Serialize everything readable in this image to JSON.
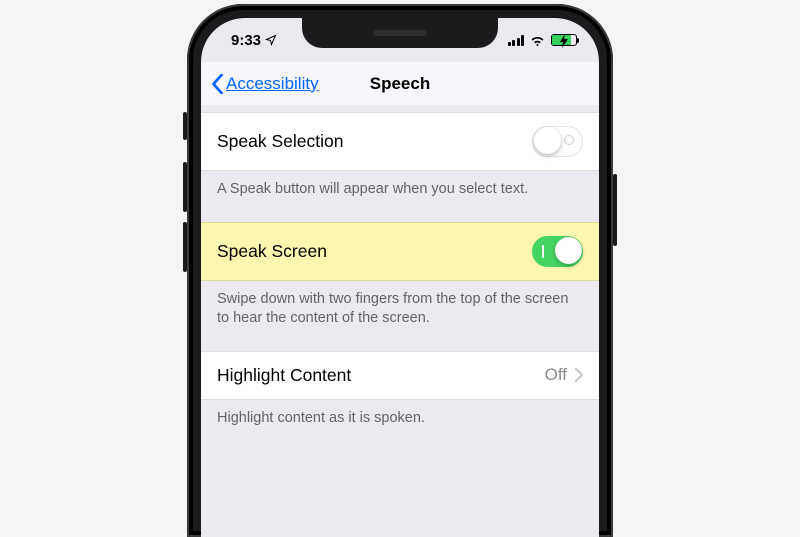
{
  "status": {
    "time": "9:33",
    "location_icon": "location-arrow"
  },
  "nav": {
    "back_label": "Accessibility",
    "title": "Speech"
  },
  "rows": {
    "speak_selection": {
      "label": "Speak Selection",
      "enabled": false,
      "footer": "A Speak button will appear when you select text."
    },
    "speak_screen": {
      "label": "Speak Screen",
      "enabled": true,
      "footer": "Swipe down with two fingers from the top of the screen to hear the content of the screen."
    },
    "highlight_content": {
      "label": "Highlight Content",
      "value": "Off",
      "footer": "Highlight content as it is spoken."
    }
  }
}
